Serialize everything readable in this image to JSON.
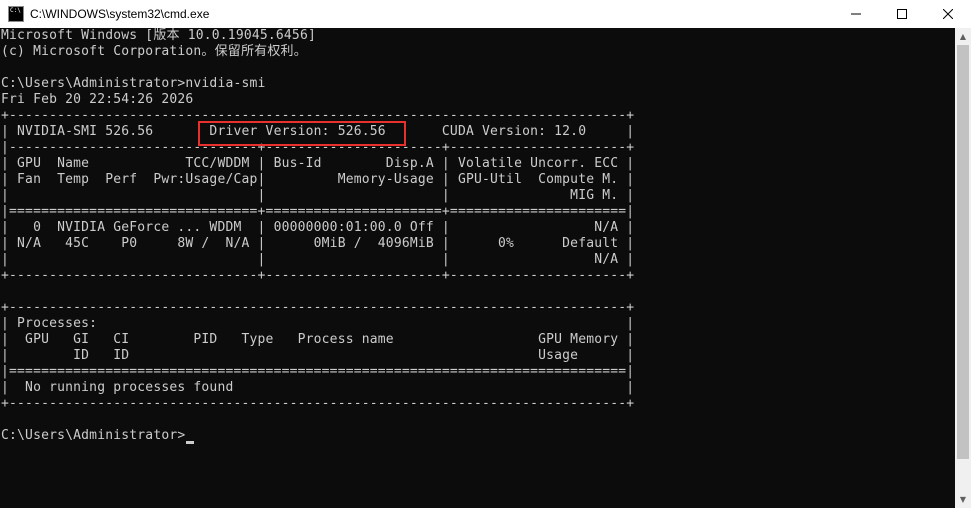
{
  "window": {
    "title": "C:\\WINDOWS\\system32\\cmd.exe",
    "icon": "cmd-app-icon",
    "controls": [
      "minimize-icon",
      "maximize-icon",
      "close-icon"
    ]
  },
  "console": {
    "lines": [
      "Microsoft Windows [版本 10.0.19045.6456]",
      "(c) Microsoft Corporation。保留所有权利。",
      "",
      "C:\\Users\\Administrator>nvidia-smi",
      "Fri Feb 20 22:54:26 2026",
      "+-----------------------------------------------------------------------------+",
      "| NVIDIA-SMI 526.56       Driver Version: 526.56       CUDA Version: 12.0     |",
      "|-------------------------------+----------------------+----------------------+",
      "| GPU  Name            TCC/WDDM | Bus-Id        Disp.A | Volatile Uncorr. ECC |",
      "| Fan  Temp  Perf  Pwr:Usage/Cap|         Memory-Usage | GPU-Util  Compute M. |",
      "|                               |                      |               MIG M. |",
      "|===============================+======================+======================|",
      "|   0  NVIDIA GeForce ... WDDM  | 00000000:01:00.0 Off |                  N/A |",
      "| N/A   45C    P0     8W /  N/A |      0MiB /  4096MiB |      0%      Default |",
      "|                               |                      |                  N/A |",
      "+-------------------------------+----------------------+----------------------+",
      "",
      "+-----------------------------------------------------------------------------+",
      "| Processes:                                                                  |",
      "|  GPU   GI   CI        PID   Type   Process name                  GPU Memory |",
      "|        ID   ID                                                   Usage      |",
      "|=============================================================================|",
      "|  No running processes found                                                 |",
      "+-----------------------------------------------------------------------------+",
      "",
      "C:\\Users\\Administrator>"
    ],
    "highlight_color": "#e8312c"
  }
}
